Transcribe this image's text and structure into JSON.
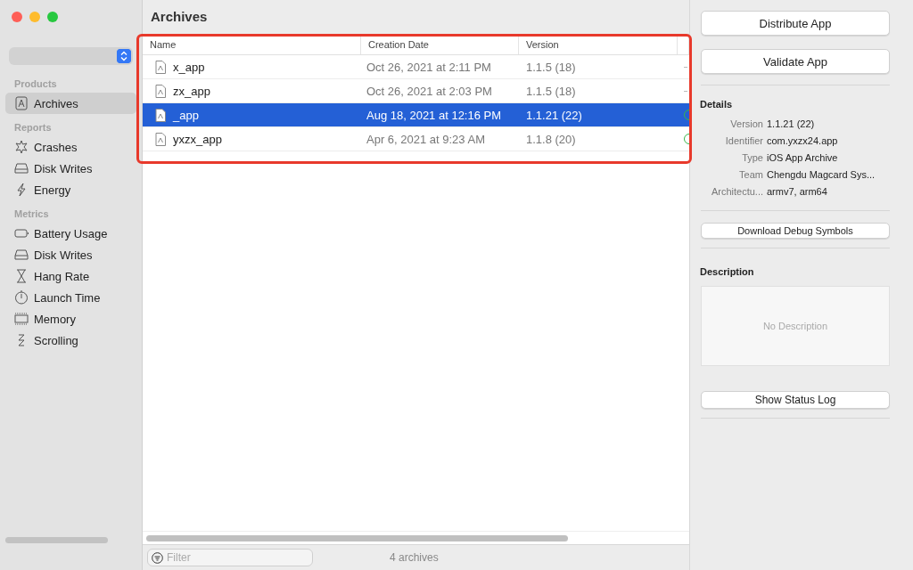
{
  "window": {
    "title": "Archives"
  },
  "sidebar": {
    "sections": [
      {
        "title": "Products",
        "items": [
          {
            "label": "Archives",
            "selected": true
          }
        ]
      },
      {
        "title": "Reports",
        "items": [
          {
            "label": "Crashes",
            "selected": false
          },
          {
            "label": "Disk Writes",
            "selected": false
          },
          {
            "label": "Energy",
            "selected": false
          }
        ]
      },
      {
        "title": "Metrics",
        "items": [
          {
            "label": "Battery Usage",
            "selected": false
          },
          {
            "label": "Disk Writes",
            "selected": false
          },
          {
            "label": "Hang Rate",
            "selected": false
          },
          {
            "label": "Launch Time",
            "selected": false
          },
          {
            "label": "Memory",
            "selected": false
          },
          {
            "label": "Scrolling",
            "selected": false
          }
        ]
      }
    ]
  },
  "table": {
    "columns": [
      "Name",
      "Creation Date",
      "Version"
    ],
    "rows": [
      {
        "name": "x_app",
        "date": "Oct 26, 2021 at 2:11 PM",
        "version": "1.1.5 (18)",
        "status_ok": false,
        "selected": false
      },
      {
        "name": "zx_app",
        "date": "Oct 26, 2021 at 2:03 PM",
        "version": "1.1.5 (18)",
        "status_ok": false,
        "selected": false
      },
      {
        "name": "_app",
        "date": "Aug 18, 2021 at 12:16 PM",
        "version": "1.1.21 (22)",
        "status_ok": true,
        "selected": true
      },
      {
        "name": "yxzx_app",
        "date": "Apr 6, 2021 at 9:23 AM",
        "version": "1.1.8 (20)",
        "status_ok": true,
        "selected": false
      }
    ]
  },
  "filter": {
    "placeholder": "Filter"
  },
  "status_bar": "4 archives",
  "inspector": {
    "buttons": [
      "Distribute App",
      "Validate App"
    ],
    "details_title": "Details",
    "details": [
      {
        "label": "Version",
        "value": "1.1.21 (22)"
      },
      {
        "label": "Identifier",
        "value": "com.yxzx24.app"
      },
      {
        "label": "Type",
        "value": "iOS App Archive"
      },
      {
        "label": "Team",
        "value": "Chengdu Magcard Sys..."
      },
      {
        "label": "Architectu...",
        "value": "armv7, arm64"
      }
    ],
    "debug_button": "Download Debug Symbols",
    "description_title": "Description",
    "description_placeholder": "No Description",
    "log_button": "Show Status Log"
  }
}
